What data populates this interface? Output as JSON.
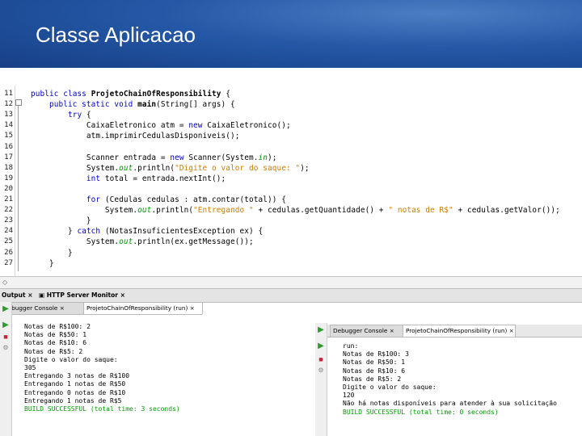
{
  "slide": {
    "title": "Classe Aplicacao"
  },
  "editor": {
    "line_numbers": [
      "11",
      "12",
      "13",
      "14",
      "15",
      "16",
      "17",
      "18",
      "19",
      "20",
      "21",
      "22",
      "23",
      "24",
      "25",
      "26",
      "27"
    ],
    "lines": [
      [
        "",
        [
          [
            "kw",
            "public class "
          ],
          [
            "cls",
            "ProjetoChainOfResponsibility"
          ],
          [
            "",
            " {"
          ]
        ]
      ],
      [
        "",
        [
          [
            "kw",
            "    public static void "
          ],
          [
            "cls",
            "main"
          ],
          [
            "",
            "(String[] args) {"
          ]
        ]
      ],
      [
        "",
        [
          [
            "kw",
            "        try "
          ],
          [
            "",
            "{"
          ]
        ]
      ],
      [
        "",
        [
          [
            "",
            "            CaixaEletronico atm = "
          ],
          [
            "kw",
            "new "
          ],
          [
            "",
            "CaixaEletronico();"
          ]
        ]
      ],
      [
        "",
        [
          [
            "",
            "            atm.imprimirCedulasDisponiveis();"
          ]
        ]
      ],
      [
        "",
        [
          [
            "",
            ""
          ]
        ]
      ],
      [
        "",
        [
          [
            "",
            "            Scanner entrada = "
          ],
          [
            "kw",
            "new "
          ],
          [
            "",
            "Scanner(System."
          ],
          [
            "fld",
            "in"
          ],
          [
            "",
            ");"
          ]
        ]
      ],
      [
        "",
        [
          [
            "",
            "            System."
          ],
          [
            "fld",
            "out"
          ],
          [
            "",
            ".println("
          ],
          [
            "str",
            "\"Digite o valor do saque: \""
          ],
          [
            "",
            ");"
          ]
        ]
      ],
      [
        "",
        [
          [
            "kw",
            "            int "
          ],
          [
            "",
            "total = entrada.nextInt();"
          ]
        ]
      ],
      [
        "",
        [
          [
            "",
            ""
          ]
        ]
      ],
      [
        "",
        [
          [
            "kw",
            "            for "
          ],
          [
            "",
            "(Cedulas cedulas : atm.contar(total)) {"
          ]
        ]
      ],
      [
        "",
        [
          [
            "",
            "                System."
          ],
          [
            "fld",
            "out"
          ],
          [
            "",
            ".println("
          ],
          [
            "str",
            "\"Entregando \""
          ],
          [
            "",
            " + cedulas.getQuantidade() + "
          ],
          [
            "str",
            "\" notas de R$\""
          ],
          [
            "",
            " + cedulas.getValor());"
          ]
        ]
      ],
      [
        "",
        [
          [
            "",
            "            }"
          ]
        ]
      ],
      [
        "",
        [
          [
            "",
            "        } "
          ],
          [
            "kw",
            "catch "
          ],
          [
            "",
            "(NotasInsuficientesException ex) {"
          ]
        ]
      ],
      [
        "",
        [
          [
            "",
            "            System."
          ],
          [
            "fld",
            "out"
          ],
          [
            "",
            ".println(ex.getMessage());"
          ]
        ]
      ],
      [
        "",
        [
          [
            "",
            "        }"
          ]
        ]
      ],
      [
        "",
        [
          [
            "",
            "    }"
          ]
        ]
      ]
    ]
  },
  "panel_tabs": {
    "output": "Output",
    "http": "HTTP Server Monitor"
  },
  "console_left": {
    "tab_debugger": "Debugger Console",
    "tab_run": "ProjetoChainOfResponsibility (run)",
    "lines": [
      "Notas de R$100: 2",
      "Notas de R$50: 1",
      "Notas de R$10: 6",
      "Notas de R$5: 2",
      "Digite o valor do saque:",
      "305",
      "Entregando 3 notas de R$100",
      "Entregando 1 notas de R$50",
      "Entregando 0 notas de R$10",
      "Entregando 1 notas de R$5"
    ],
    "build": "BUILD SUCCESSFUL (total time: 3 seconds)"
  },
  "console_right": {
    "tab_debugger": "Debugger Console",
    "tab_run": "ProjetoChainOfResponsibility (run)",
    "lines": [
      "run:",
      "Notas de R$100: 3",
      "Notas de R$50: 1",
      "Notas de R$10: 6",
      "Notas de R$5: 2",
      "Digite o valor do saque:",
      "120",
      "Não há notas disponíveis para atender à sua solicitação"
    ],
    "build": "BUILD SUCCESSFUL (total time: 0 seconds)"
  }
}
